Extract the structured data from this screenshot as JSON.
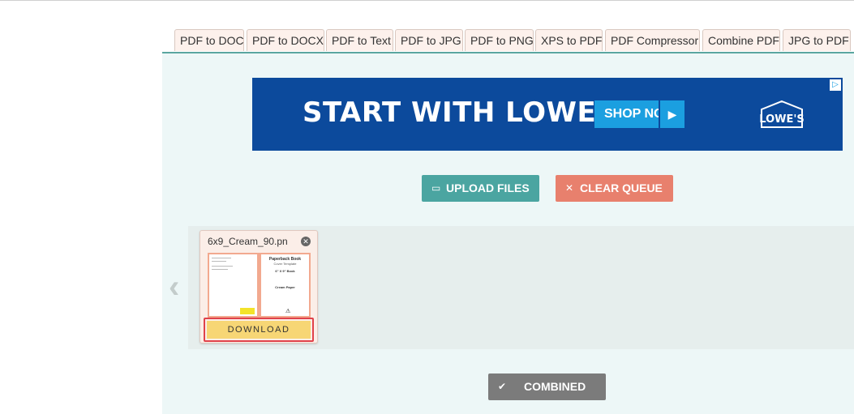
{
  "tabs": [
    {
      "label": "PDF to DOC"
    },
    {
      "label": "PDF to DOCX"
    },
    {
      "label": "PDF to Text"
    },
    {
      "label": "PDF to JPG"
    },
    {
      "label": "PDF to PNG"
    },
    {
      "label": "XPS to PDF"
    },
    {
      "label": "PDF Compressor"
    },
    {
      "label": "Combine PDF"
    },
    {
      "label": "JPG to PDF"
    }
  ],
  "ad": {
    "headline": "START WITH LOWE'S",
    "cta": "SHOP NOW",
    "logo_text": "LOWE'S",
    "brand_color": "#0c4a9c",
    "cta_color": "#1b9fe0"
  },
  "actions": {
    "upload_label": "UPLOAD FILES",
    "clear_label": "CLEAR QUEUE",
    "combined_label": "COMBINED",
    "upload_icon": "folder-open-icon",
    "clear_icon": "close-icon",
    "combined_icon": "checkmark-icon"
  },
  "queue": {
    "files": [
      {
        "name": "6x9_Cream_90.pn",
        "download_label": "DOWNLOAD",
        "thumb_text": {
          "title": "Paperback Book",
          "subtitle": "Cover Template",
          "size": "6\" X 9\" Book",
          "paper": "Cream Paper"
        }
      }
    ]
  },
  "colors": {
    "panel": "#edf7f7",
    "tab": "#fdf1ec",
    "upload": "#4ba5a1",
    "clear": "#e8806d",
    "download": "#f7d675",
    "combined": "#7b7b7b",
    "highlight": "#e0424a"
  }
}
